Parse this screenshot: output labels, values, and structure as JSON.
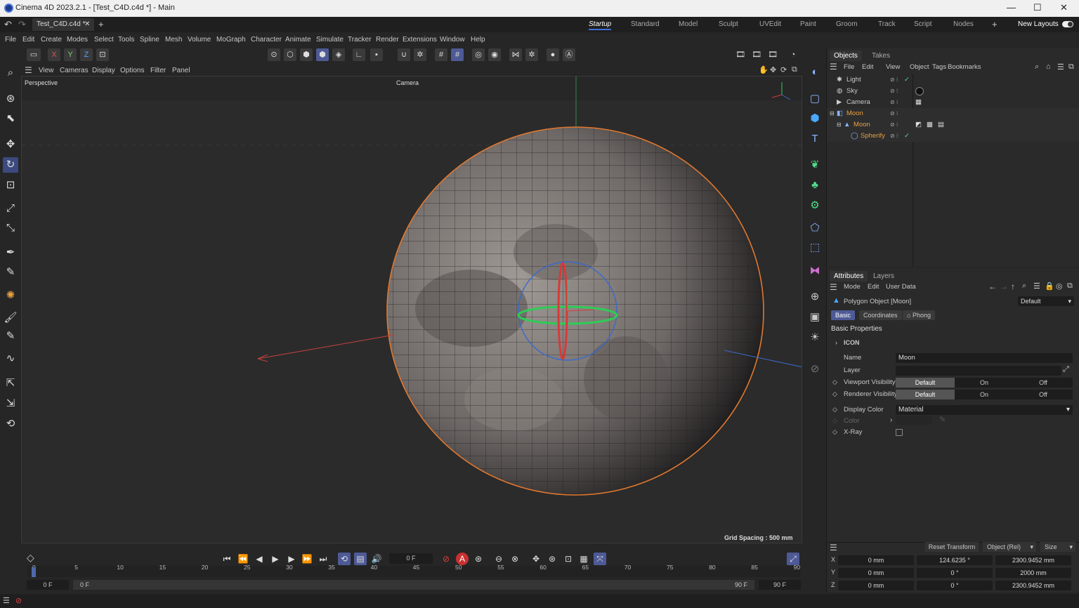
{
  "window": {
    "title": "Cinema 4D 2023.2.1 - [Test_C4D.c4d *] - Main",
    "minimize": "—",
    "maximize": "☐",
    "close": "✕"
  },
  "doc_tab": {
    "name": "Test_C4D.c4d *",
    "close": "✕",
    "add": "+"
  },
  "layouts": [
    "Startup",
    "Standard",
    "Model",
    "Sculpt",
    "UVEdit",
    "Paint",
    "Groom",
    "Track",
    "Script",
    "Nodes"
  ],
  "layout_add": "+",
  "new_layouts": "New Layouts",
  "menu": [
    "File",
    "Edit",
    "Create",
    "Modes",
    "Select",
    "Tools",
    "Spline",
    "Mesh",
    "Volume",
    "MoGraph",
    "Character",
    "Animate",
    "Simulate",
    "Tracker",
    "Render",
    "Extensions",
    "Window",
    "Help"
  ],
  "axis_toggles": [
    "X",
    "Y",
    "Z"
  ],
  "viewport_menu": [
    "View",
    "Cameras",
    "Display",
    "Options",
    "Filter",
    "Panel"
  ],
  "viewport": {
    "name": "Perspective",
    "camera": "Camera",
    "grid_spacing": "Grid Spacing : 500 mm"
  },
  "objects_panel": {
    "tabs": [
      "Objects",
      "Takes"
    ],
    "menu": [
      "File",
      "Edit",
      "View",
      "Object",
      "Tags",
      "Bookmarks"
    ],
    "items": [
      {
        "name": "Light",
        "indent": 0,
        "color": "#c8c8c8",
        "icon": "light-icon"
      },
      {
        "name": "Sky",
        "indent": 0,
        "color": "#c8c8c8",
        "icon": "sky-icon"
      },
      {
        "name": "Camera",
        "indent": 0,
        "color": "#c8c8c8",
        "icon": "camera-icon"
      },
      {
        "name": "Moon",
        "indent": 0,
        "color": "#e8a040",
        "icon": "null-icon"
      },
      {
        "name": "Moon",
        "indent": 1,
        "color": "#e8a040",
        "icon": "polygon-icon"
      },
      {
        "name": "Spherify",
        "indent": 2,
        "color": "#e8a040",
        "icon": "deformer-icon"
      }
    ]
  },
  "attributes_panel": {
    "tabs": [
      "Attributes",
      "Layers"
    ],
    "menu": [
      "Mode",
      "Edit",
      "User Data"
    ],
    "object_type": "Polygon Object [Moon]",
    "preset": "Default",
    "sub_tabs": [
      "Basic",
      "Coordinates",
      "Phong"
    ],
    "section": "Basic Properties",
    "icon_group": "ICON",
    "name_label": "Name",
    "name_value": "Moon",
    "layer_label": "Layer",
    "viewport_visibility": {
      "label": "Viewport Visibility",
      "options": [
        "Default",
        "On",
        "Off"
      ]
    },
    "renderer_visibility": {
      "label": "Renderer Visibility",
      "options": [
        "Default",
        "On",
        "Off"
      ]
    },
    "display_color": {
      "label": "Display Color",
      "value": "Material"
    },
    "color_label": "Color",
    "xray_label": "X-Ray"
  },
  "coords": {
    "reset": "Reset Transform",
    "mode": "Object (Rel)",
    "size_mode": "Size",
    "rows": [
      {
        "axis": "X",
        "pos": "0 mm",
        "rot": "124.6235 °",
        "size": "2300.9452 mm"
      },
      {
        "axis": "Y",
        "pos": "0 mm",
        "rot": "0 °",
        "size": "2000 mm"
      },
      {
        "axis": "Z",
        "pos": "0 mm",
        "rot": "0 °",
        "size": "2300.9452 mm"
      }
    ]
  },
  "timeline": {
    "current_frame": "0 F",
    "ruler": [
      "0",
      "5",
      "10",
      "15",
      "20",
      "25",
      "30",
      "35",
      "40",
      "45",
      "50",
      "55",
      "60",
      "65",
      "70",
      "75",
      "80",
      "85",
      "90"
    ],
    "range_start": "0 F",
    "range_start2": "0 F",
    "range_end": "90 F",
    "range_end2": "90 F"
  }
}
